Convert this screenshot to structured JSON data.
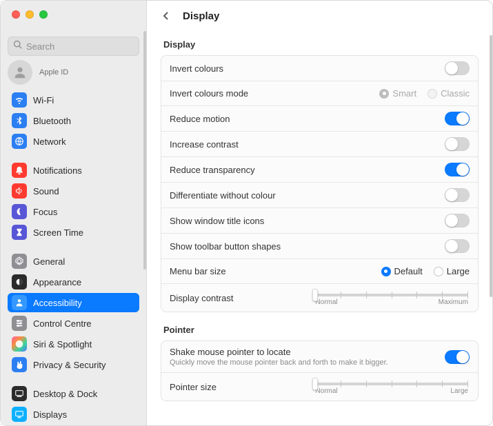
{
  "window": {
    "title": "Display"
  },
  "search": {
    "placeholder": "Search"
  },
  "user": {
    "label": "Apple ID"
  },
  "sidebar": {
    "groups": [
      [
        {
          "name": "wifi",
          "label": "Wi-Fi",
          "icon": "wifi",
          "color": "ic-blue"
        },
        {
          "name": "bluetooth",
          "label": "Bluetooth",
          "icon": "bluetooth",
          "color": "ic-blue"
        },
        {
          "name": "network",
          "label": "Network",
          "icon": "network",
          "color": "ic-blue"
        }
      ],
      [
        {
          "name": "notifications",
          "label": "Notifications",
          "icon": "bell",
          "color": "ic-red"
        },
        {
          "name": "sound",
          "label": "Sound",
          "icon": "speaker",
          "color": "ic-red"
        },
        {
          "name": "focus",
          "label": "Focus",
          "icon": "moon",
          "color": "ic-indigo"
        },
        {
          "name": "screen-time",
          "label": "Screen Time",
          "icon": "hourglass",
          "color": "ic-indigo"
        }
      ],
      [
        {
          "name": "general",
          "label": "General",
          "icon": "gear",
          "color": "ic-gray"
        },
        {
          "name": "appearance",
          "label": "Appearance",
          "icon": "appearance",
          "color": "ic-black"
        },
        {
          "name": "accessibility",
          "label": "Accessibility",
          "icon": "person",
          "color": "ic-blue",
          "selected": true
        },
        {
          "name": "control-centre",
          "label": "Control Centre",
          "icon": "sliders",
          "color": "ic-gray"
        },
        {
          "name": "siri-spotlight",
          "label": "Siri & Spotlight",
          "icon": "siri",
          "color": "ic-grad"
        },
        {
          "name": "privacy-security",
          "label": "Privacy & Security",
          "icon": "hand",
          "color": "ic-blue"
        }
      ],
      [
        {
          "name": "desktop-dock",
          "label": "Desktop & Dock",
          "icon": "dock",
          "color": "ic-black"
        },
        {
          "name": "displays",
          "label": "Displays",
          "icon": "display",
          "color": "ic-cyan"
        }
      ]
    ]
  },
  "panel": {
    "sections": [
      {
        "heading": "Display",
        "rows": [
          {
            "key": "invert-colours",
            "label": "Invert colours",
            "toggle": false
          },
          {
            "key": "invert-colours-mode",
            "label": "Invert colours mode",
            "radios": {
              "disabled": true,
              "selected": "Smart",
              "options": [
                "Smart",
                "Classic"
              ]
            }
          },
          {
            "key": "reduce-motion",
            "label": "Reduce motion",
            "toggle": true
          },
          {
            "key": "increase-contrast",
            "label": "Increase contrast",
            "toggle": false
          },
          {
            "key": "reduce-transparency",
            "label": "Reduce transparency",
            "toggle": true
          },
          {
            "key": "differentiate-without-colour",
            "label": "Differentiate without colour",
            "toggle": false
          },
          {
            "key": "show-window-title-icons",
            "label": "Show window title icons",
            "toggle": false
          },
          {
            "key": "show-toolbar-button-shapes",
            "label": "Show toolbar button shapes",
            "toggle": false
          },
          {
            "key": "menu-bar-size",
            "label": "Menu bar size",
            "radios": {
              "disabled": false,
              "selected": "Default",
              "options": [
                "Default",
                "Large"
              ]
            }
          },
          {
            "key": "display-contrast",
            "label": "Display contrast",
            "slider": {
              "min_label": "Normal",
              "max_label": "Maximum",
              "position": 0
            }
          }
        ]
      },
      {
        "heading": "Pointer",
        "rows": [
          {
            "key": "shake-pointer",
            "label": "Shake mouse pointer to locate",
            "sublabel": "Quickly move the mouse pointer back and forth to make it bigger.",
            "toggle": true
          },
          {
            "key": "pointer-size",
            "label": "Pointer size",
            "slider": {
              "min_label": "Normal",
              "max_label": "Large",
              "position": 0
            }
          }
        ]
      }
    ]
  }
}
